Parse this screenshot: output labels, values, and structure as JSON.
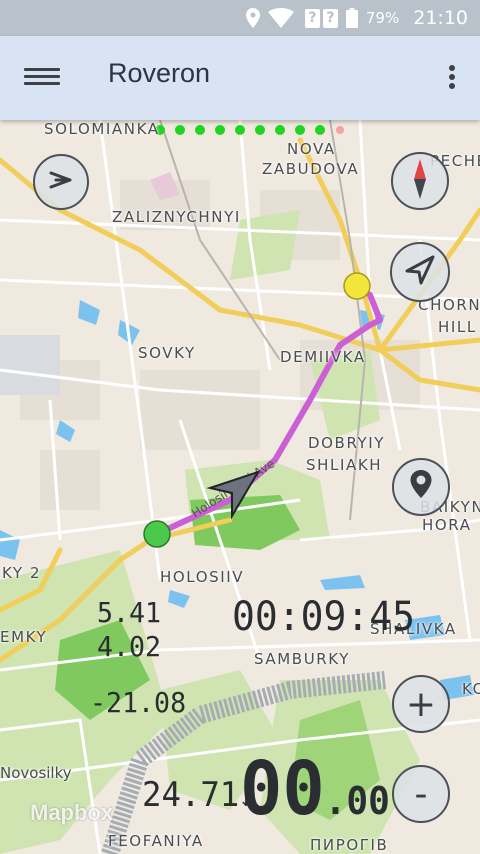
{
  "status_bar": {
    "icons": [
      "location-icon",
      "wifi-icon",
      "unknown-signal-icon",
      "unknown-signal-icon",
      "battery-icon"
    ],
    "battery_level": "79%",
    "time": "21:10"
  },
  "app_bar": {
    "title": "Roveron",
    "menu_icon": "hamburger-menu-icon",
    "overflow_icon": "more-vert-icon"
  },
  "map": {
    "labels": {
      "solomianka": "SOLOMIANKA",
      "nova_zabudova_1": "NOVA",
      "nova_zabudova_2": "ZABUDOVA",
      "pecher": "PECHER",
      "zaliznychnyi": "ZALIZNYCHNYI",
      "chorn": "CHORN",
      "hill": "HILL",
      "sovky": "SOVKY",
      "demiivka": "DEMIIVKA",
      "dobryi_1": "DOBRYIY",
      "dobryi_2": "SHLIAKH",
      "baikove_1": "BAIKYNO",
      "baikove_2": "HORA",
      "holosiiv": "HOLOSIIV",
      "ky2": "KY 2",
      "mky": "EMKY",
      "shalivka": "SHALIVKA",
      "samburky": "SAMBURKY",
      "ko": "KO",
      "novosilky": "Novosilky",
      "feofaniya": "FEOFANIYA",
      "pyrohiv": "ПИРОГІВ",
      "street": "Holosiivskyi Ave"
    },
    "attribution": "Mapbox",
    "route_color": "#cc5fd4",
    "start_marker_color": "#4cc94c",
    "end_marker_color": "#f2e53c",
    "progress_dots": {
      "filled": 9,
      "total": 10,
      "filled_color": "#1fd51f",
      "empty_color": "#f2a3a3"
    }
  },
  "controls": {
    "pan_icon": "arrow-right-icon",
    "compass_icon": "compass-icon",
    "navigate_icon": "navigation-arrow-icon",
    "location_icon": "map-pin-icon",
    "zoom_in_label": "+",
    "zoom_out_label": "-"
  },
  "readouts": {
    "value1": "5.41",
    "value2": "4.02",
    "value3": "-21.08",
    "elapsed_time": "00:09:45",
    "distance": "24.71",
    "distance_arrow": "↓",
    "speed_main": "00",
    "speed_decimal": ".00"
  }
}
